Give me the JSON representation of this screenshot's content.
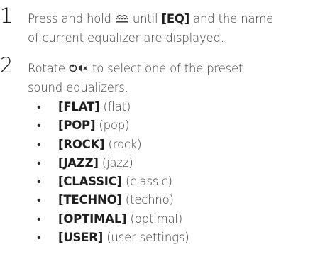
{
  "steps": [
    {
      "number": "1",
      "line1_before": "Press and hold ",
      "line1_icon": "sound-button-icon",
      "line1_middle": " until ",
      "line1_bold": "[EQ]",
      "line1_after": " and the name",
      "line2": "of current equalizer are displayed."
    },
    {
      "number": "2",
      "line1_before": "Rotate ",
      "line1_icon": "volume-knob-icon",
      "line1_after": " to select one of the preset",
      "line2": "sound equalizers."
    }
  ],
  "equalizers": [
    {
      "bullet": "•",
      "label": "[FLAT]",
      "desc": " (flat)"
    },
    {
      "bullet": "•",
      "label": "[POP]",
      "desc": " (pop)"
    },
    {
      "bullet": "•",
      "label": "[ROCK]",
      "desc": " (rock)"
    },
    {
      "bullet": "•",
      "label": "[JAZZ]",
      "desc": " (jazz)"
    },
    {
      "bullet": "•",
      "label": "[CLASSIC]",
      "desc": " (classic)"
    },
    {
      "bullet": "•",
      "label": "[TECHNO]",
      "desc": " (techno)"
    },
    {
      "bullet": "•",
      "label": "[OPTIMAL]",
      "desc": " (optimal)"
    },
    {
      "bullet": "•",
      "label": "[USER]",
      "desc": " (user settings)"
    }
  ]
}
